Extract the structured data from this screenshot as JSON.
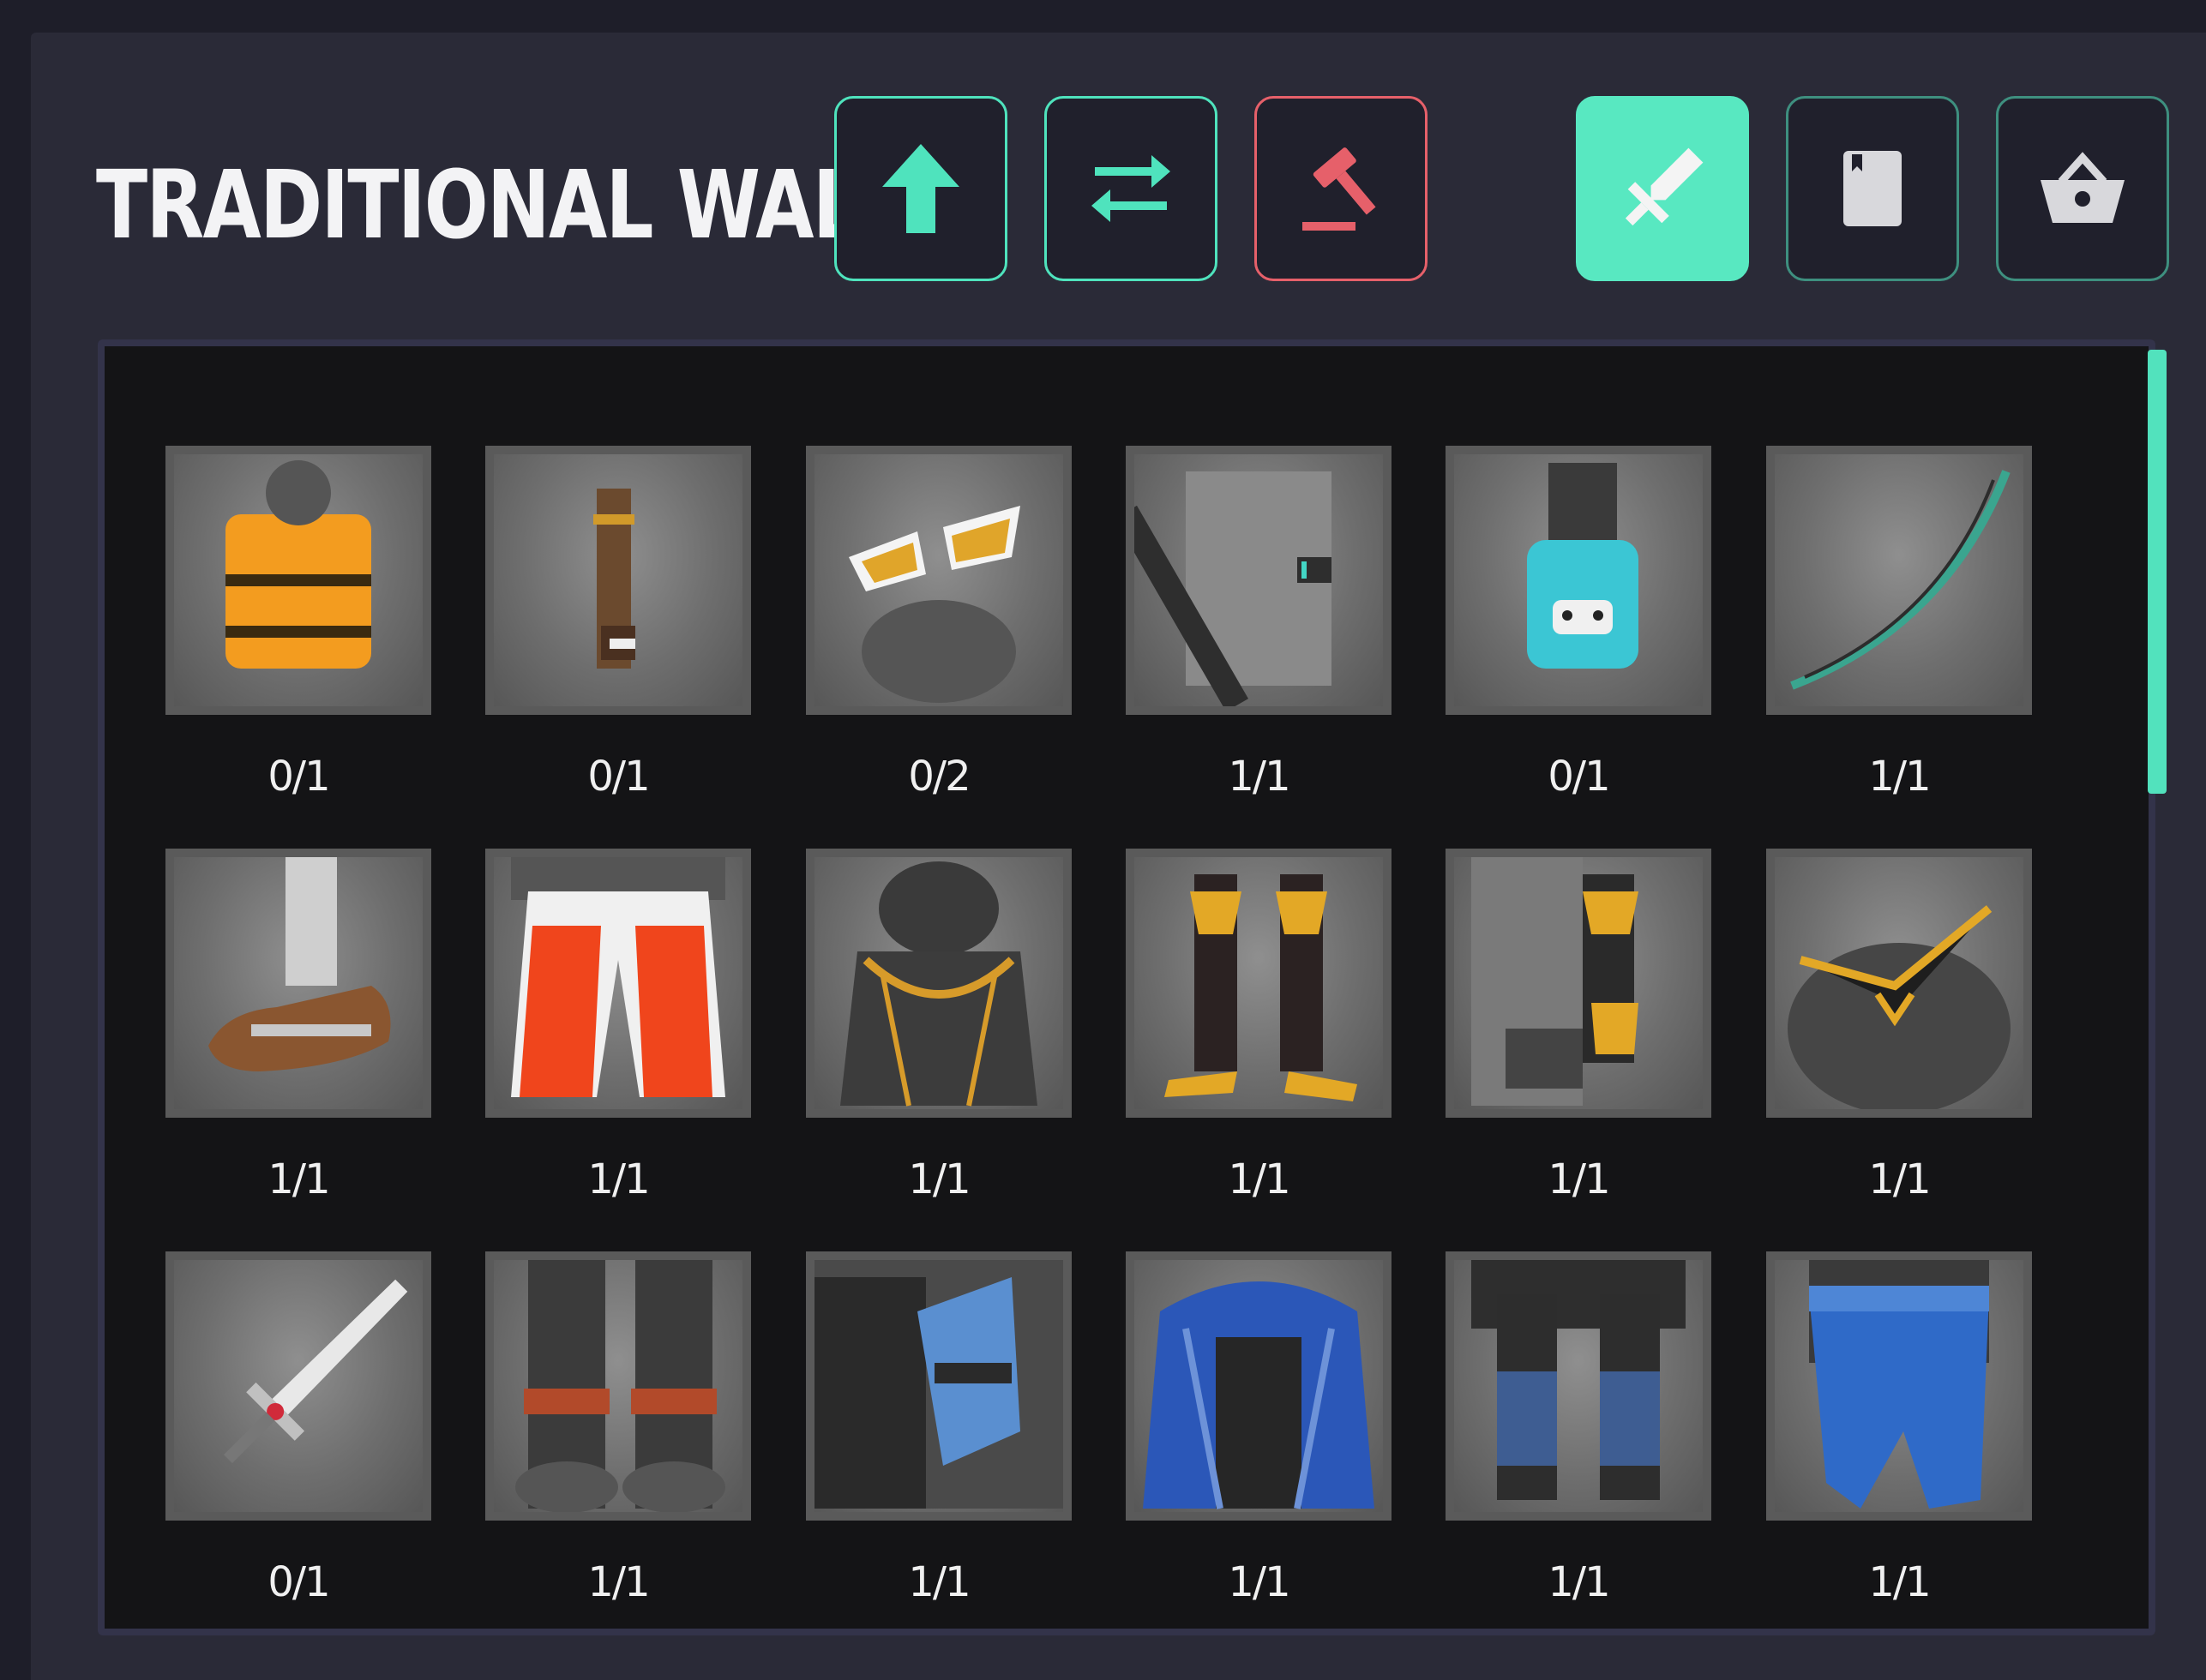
{
  "header": {
    "title": "TRADITIONAL WALLET"
  },
  "toolbar": {
    "actions": [
      {
        "name": "upload",
        "icon": "arrow-up-icon",
        "color": "#4fe3bd"
      },
      {
        "name": "transfer",
        "icon": "swap-arrows-icon",
        "color": "#4fe3bd"
      },
      {
        "name": "auction",
        "icon": "gavel-icon",
        "color": "#e6606a"
      }
    ],
    "tabs": [
      {
        "name": "items",
        "icon": "sword-icon",
        "active": true
      },
      {
        "name": "cards",
        "icon": "card-icon",
        "active": false
      },
      {
        "name": "shop",
        "icon": "basket-icon",
        "active": false
      }
    ]
  },
  "colors": {
    "accent": "#58e8c1",
    "danger": "#e6606a",
    "panel": "#2a2a37",
    "grid_background": "#141416"
  },
  "inventory": {
    "items": [
      {
        "icon": "life-vest-icon",
        "count": "0/1"
      },
      {
        "icon": "arm-wrap-icon",
        "count": "0/1"
      },
      {
        "icon": "goggles-icon",
        "count": "0/2"
      },
      {
        "icon": "chest-strap-icon",
        "count": "1/1"
      },
      {
        "icon": "glove-icon",
        "count": "0/1"
      },
      {
        "icon": "bow-icon",
        "count": "1/1"
      },
      {
        "icon": "loafer-icon",
        "count": "1/1"
      },
      {
        "icon": "shorts-icon",
        "count": "1/1"
      },
      {
        "icon": "armor-top-icon",
        "count": "1/1"
      },
      {
        "icon": "heeled-boots-icon",
        "count": "1/1"
      },
      {
        "icon": "gauntlet-icon",
        "count": "1/1"
      },
      {
        "icon": "tiara-icon",
        "count": "1/1"
      },
      {
        "icon": "sword-icon",
        "count": "0/1"
      },
      {
        "icon": "fur-boots-icon",
        "count": "1/1"
      },
      {
        "icon": "blue-arm-guard-icon",
        "count": "1/1"
      },
      {
        "icon": "blue-cloak-icon",
        "count": "1/1"
      },
      {
        "icon": "blue-leg-wraps-icon",
        "count": "1/1"
      },
      {
        "icon": "blue-sash-icon",
        "count": "1/1"
      }
    ]
  }
}
